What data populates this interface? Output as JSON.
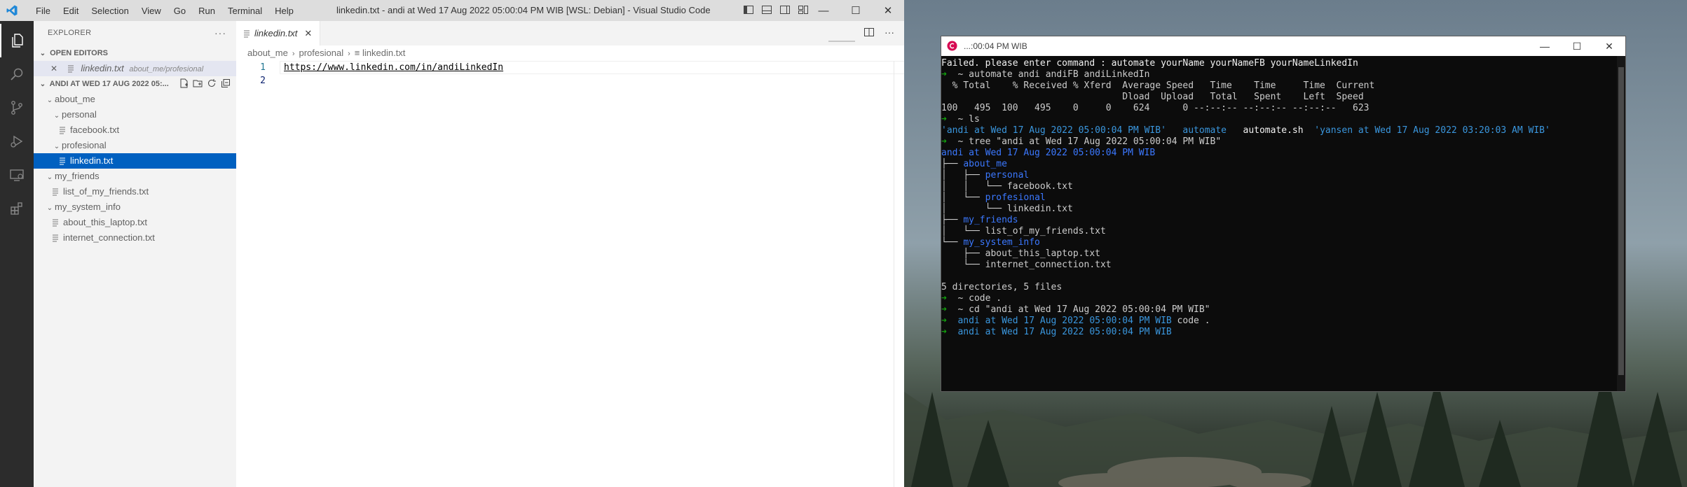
{
  "vscode": {
    "menu": [
      "File",
      "Edit",
      "Selection",
      "View",
      "Go",
      "Run",
      "Terminal",
      "Help"
    ],
    "title": "linkedin.txt - andi at Wed 17 Aug 2022 05:00:04 PM WIB [WSL: Debian] - Visual Studio Code",
    "window_controls": {
      "minimize": "—",
      "maximize": "☐",
      "close": "✕"
    },
    "sidebar": {
      "header": "EXPLORER",
      "more": "···",
      "open_editors_label": "OPEN EDITORS",
      "open_editor": {
        "close": "✕",
        "name": "linkedin.txt",
        "path": "about_me/profesional"
      },
      "folder_label": "ANDI AT WED 17 AUG 2022 05:...",
      "tree": [
        {
          "label": "about_me",
          "type": "folder",
          "depth": 1
        },
        {
          "label": "personal",
          "type": "folder",
          "depth": 2
        },
        {
          "label": "facebook.txt",
          "type": "file",
          "depth": 3
        },
        {
          "label": "profesional",
          "type": "folder",
          "depth": 2
        },
        {
          "label": "linkedin.txt",
          "type": "file",
          "depth": 3,
          "selected": true
        },
        {
          "label": "my_friends",
          "type": "folder",
          "depth": 1
        },
        {
          "label": "list_of_my_friends.txt",
          "type": "file",
          "depth": 2
        },
        {
          "label": "my_system_info",
          "type": "folder",
          "depth": 1
        },
        {
          "label": "about_this_laptop.txt",
          "type": "file",
          "depth": 2
        },
        {
          "label": "internet_connection.txt",
          "type": "file",
          "depth": 2
        }
      ]
    },
    "editor": {
      "tab_label": "linkedin.txt",
      "tab_close": "✕",
      "breadcrumb": [
        "about_me",
        "profesional",
        "linkedin.txt"
      ],
      "lines": [
        "https://www.linkedin.com/in/andiLinkedIn",
        ""
      ]
    },
    "colors": {
      "selection": "#0060c0",
      "activity_bar": "#2c2c2c",
      "sidebar": "#f3f3f3"
    }
  },
  "terminal": {
    "title": "...:00:04 PM WIB",
    "window_controls": {
      "minimize": "—",
      "maximize": "☐",
      "close": "✕"
    },
    "lines": [
      [
        {
          "t": "Failed. please enter command : automate yourName yourNameFB yourNameLinkedIn",
          "c": "w"
        }
      ],
      [
        {
          "t": "➜",
          "c": "g"
        },
        {
          "t": "  ~ automate andi andiFB andiLinkedIn",
          "c": ""
        }
      ],
      [
        {
          "t": "  % Total    % Received % Xferd  Average Speed   Time    Time     Time  Current",
          "c": ""
        }
      ],
      [
        {
          "t": "                                 Dload  Upload   Total   Spent    Left  Speed",
          "c": ""
        }
      ],
      [
        {
          "t": "100   495  100   495    0     0    624      0 --:--:-- --:--:-- --:--:--   623",
          "c": ""
        }
      ],
      [
        {
          "t": "➜",
          "c": "g"
        },
        {
          "t": "  ~ ls",
          "c": ""
        }
      ],
      [
        {
          "t": "'andi at Wed 17 Aug 2022 05:00:04 PM WIB'",
          "c": "c"
        },
        {
          "t": "   ",
          "c": ""
        },
        {
          "t": "automate",
          "c": "c"
        },
        {
          "t": "   automate.sh  ",
          "c": "w"
        },
        {
          "t": "'yansen at Wed 17 Aug 2022 03:20:03 AM WIB'",
          "c": "c"
        }
      ],
      [
        {
          "t": "➜",
          "c": "g"
        },
        {
          "t": "  ~ tree \"andi at Wed 17 Aug 2022 05:00:04 PM WIB\"",
          "c": ""
        }
      ],
      [
        {
          "t": "andi at Wed 17 Aug 2022 05:00:04 PM WIB",
          "c": "b"
        }
      ],
      [
        {
          "t": "├── ",
          "c": ""
        },
        {
          "t": "about_me",
          "c": "b"
        }
      ],
      [
        {
          "t": "│   ├── ",
          "c": ""
        },
        {
          "t": "personal",
          "c": "b"
        }
      ],
      [
        {
          "t": "│   │   └── facebook.txt",
          "c": ""
        }
      ],
      [
        {
          "t": "│   └── ",
          "c": ""
        },
        {
          "t": "profesional",
          "c": "b"
        }
      ],
      [
        {
          "t": "│       └── linkedin.txt",
          "c": ""
        }
      ],
      [
        {
          "t": "├── ",
          "c": ""
        },
        {
          "t": "my_friends",
          "c": "b"
        }
      ],
      [
        {
          "t": "│   └── list_of_my_friends.txt",
          "c": ""
        }
      ],
      [
        {
          "t": "└── ",
          "c": ""
        },
        {
          "t": "my_system_info",
          "c": "b"
        }
      ],
      [
        {
          "t": "    ├── about_this_laptop.txt",
          "c": ""
        }
      ],
      [
        {
          "t": "    └── internet_connection.txt",
          "c": ""
        }
      ],
      [
        {
          "t": "",
          "c": ""
        }
      ],
      [
        {
          "t": "5 directories, 5 files",
          "c": ""
        }
      ],
      [
        {
          "t": "➜",
          "c": "g"
        },
        {
          "t": "  ~ code .",
          "c": ""
        }
      ],
      [
        {
          "t": "➜",
          "c": "g"
        },
        {
          "t": "  ~ cd \"andi at Wed 17 Aug 2022 05:00:04 PM WIB\"",
          "c": ""
        }
      ],
      [
        {
          "t": "➜",
          "c": "g"
        },
        {
          "t": "  andi at Wed 17 Aug 2022 05:00:04 PM WIB",
          "c": "c"
        },
        {
          "t": " code .",
          "c": ""
        }
      ],
      [
        {
          "t": "➜",
          "c": "g"
        },
        {
          "t": "  andi at Wed 17 Aug 2022 05:00:04 PM WIB",
          "c": "c"
        }
      ]
    ]
  }
}
